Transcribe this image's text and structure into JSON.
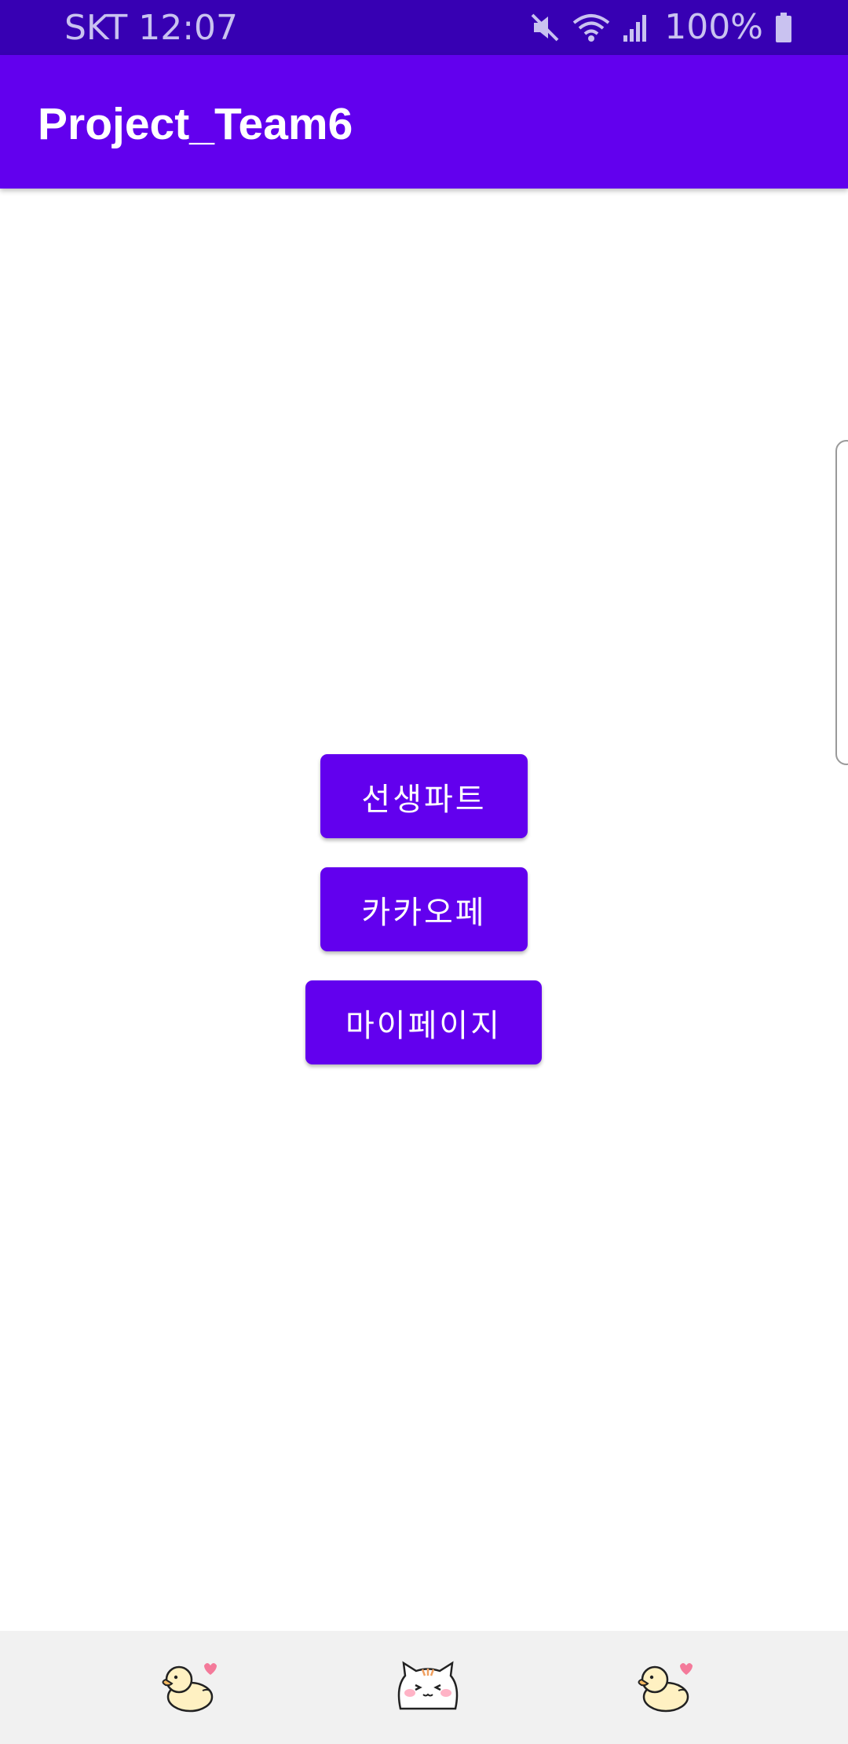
{
  "status_bar": {
    "carrier_time": "SKT 12:07",
    "battery": "100%"
  },
  "app_bar": {
    "title": "Project_Team6"
  },
  "buttons": {
    "teacher_part": "선생파트",
    "kakao_cafe": "카카오페",
    "my_page": "마이페이지"
  },
  "bottom_nav": {
    "items": [
      "duck-icon",
      "cat-icon",
      "duck-icon"
    ]
  },
  "colors": {
    "status_bar": "#3700b3",
    "primary": "#6200ee",
    "bottom_bar": "#f1f1f1"
  }
}
